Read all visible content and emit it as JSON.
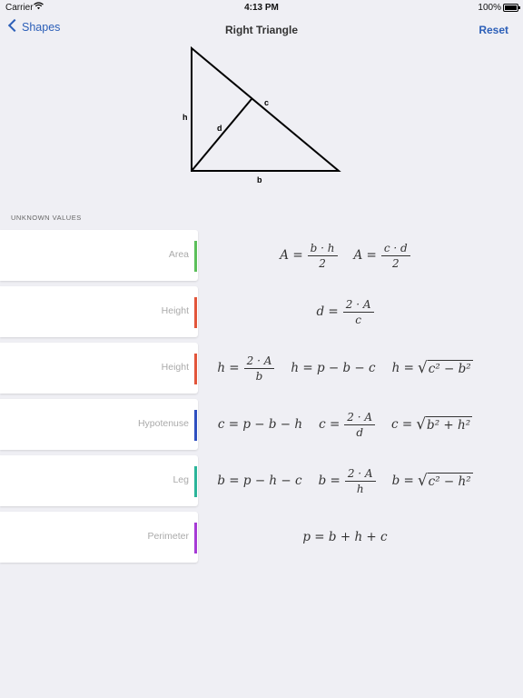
{
  "status": {
    "carrier": "Carrier",
    "time": "4:13 PM",
    "battery": "100%"
  },
  "nav": {
    "back_label": "Shapes",
    "title": "Right Triangle",
    "reset_label": "Reset"
  },
  "diagram": {
    "labels": {
      "h": "h",
      "c": "c",
      "d": "d",
      "b": "b"
    }
  },
  "section_header": "UNKNOWN VALUES",
  "rows": [
    {
      "label": "Area",
      "color": "#5bbf5a"
    },
    {
      "label": "Height",
      "color": "#e2553a"
    },
    {
      "label": "Height",
      "color": "#e2553a"
    },
    {
      "label": "Hypotenuse",
      "color": "#2e4fc0"
    },
    {
      "label": "Leg",
      "color": "#2bb59a"
    },
    {
      "label": "Perimeter",
      "color": "#a63ad6"
    }
  ],
  "formulas": {
    "area": [
      {
        "lhs": "A =",
        "num": "b · h",
        "den": "2"
      },
      {
        "lhs": "A =",
        "num": "c · d",
        "den": "2"
      }
    ],
    "height_d": [
      {
        "lhs": "d =",
        "num": "2 · A",
        "den": "c"
      }
    ],
    "height_h": {
      "frac": {
        "lhs": "h =",
        "num": "2 · A",
        "den": "b"
      },
      "sum": "h = p − b − c",
      "sqrt": {
        "lhs": "h =",
        "rad": "c² − b²"
      }
    },
    "hypotenuse": {
      "sum": "c = p − b − h",
      "frac": {
        "lhs": "c =",
        "num": "2 · A",
        "den": "d"
      },
      "sqrt": {
        "lhs": "c =",
        "rad": "b² + h²"
      }
    },
    "leg": {
      "sum": "b = p − h − c",
      "frac": {
        "lhs": "b =",
        "num": "2 · A",
        "den": "h"
      },
      "sqrt": {
        "lhs": "b =",
        "rad": "c² − h²"
      }
    },
    "perimeter": "p = b + h + c"
  }
}
